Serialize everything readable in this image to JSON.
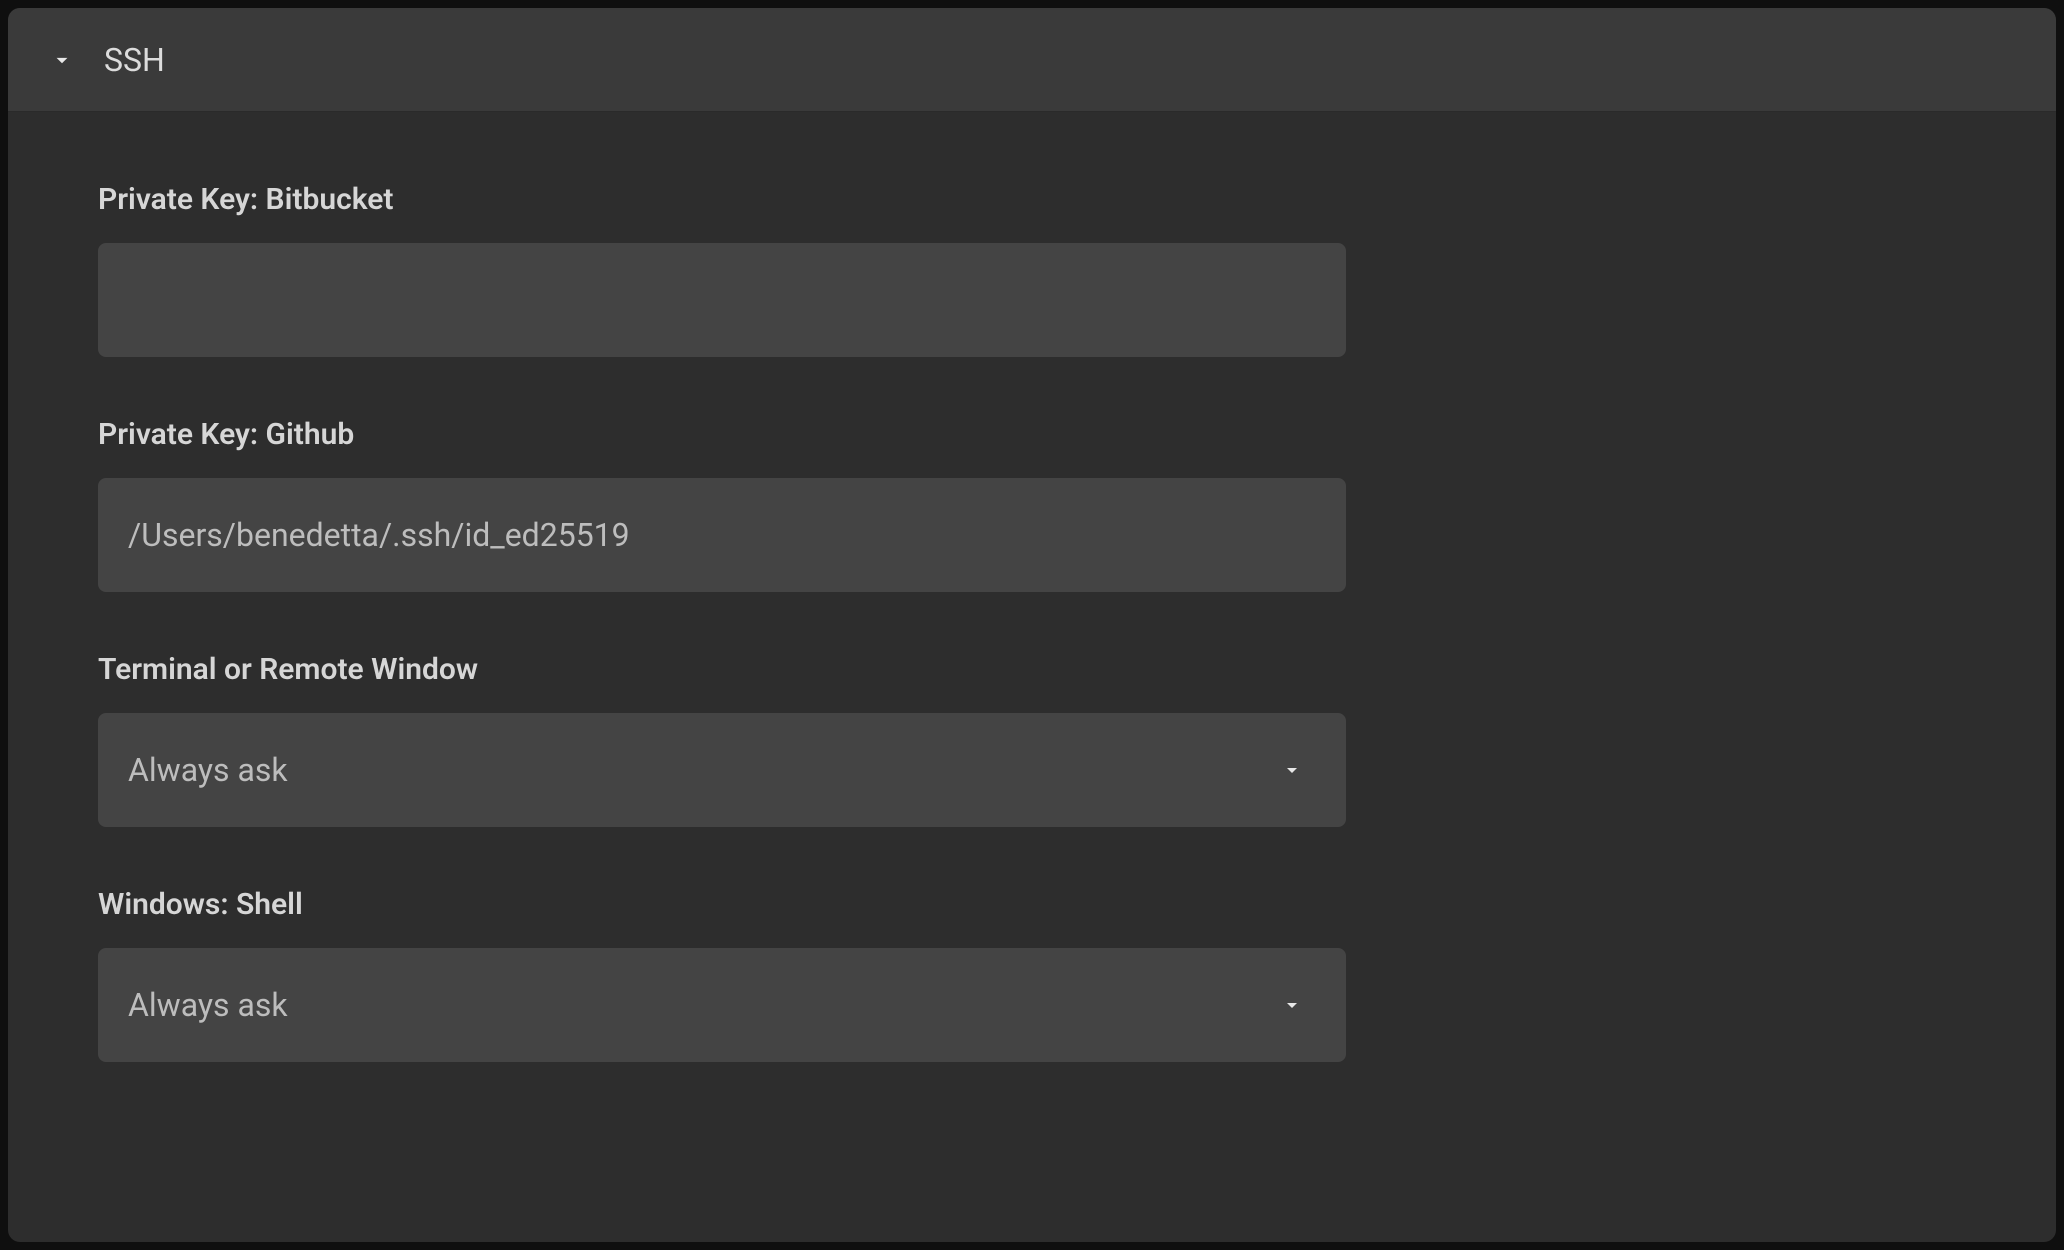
{
  "section": {
    "title": "SSH"
  },
  "fields": {
    "privateKeyBitbucket": {
      "label": "Private Key: Bitbucket",
      "value": ""
    },
    "privateKeyGithub": {
      "label": "Private Key: Github",
      "value": "/Users/benedetta/.ssh/id_ed25519"
    },
    "terminalRemote": {
      "label": "Terminal or Remote Window",
      "value": "Always ask"
    },
    "windowsShell": {
      "label": "Windows: Shell",
      "value": "Always ask"
    }
  }
}
